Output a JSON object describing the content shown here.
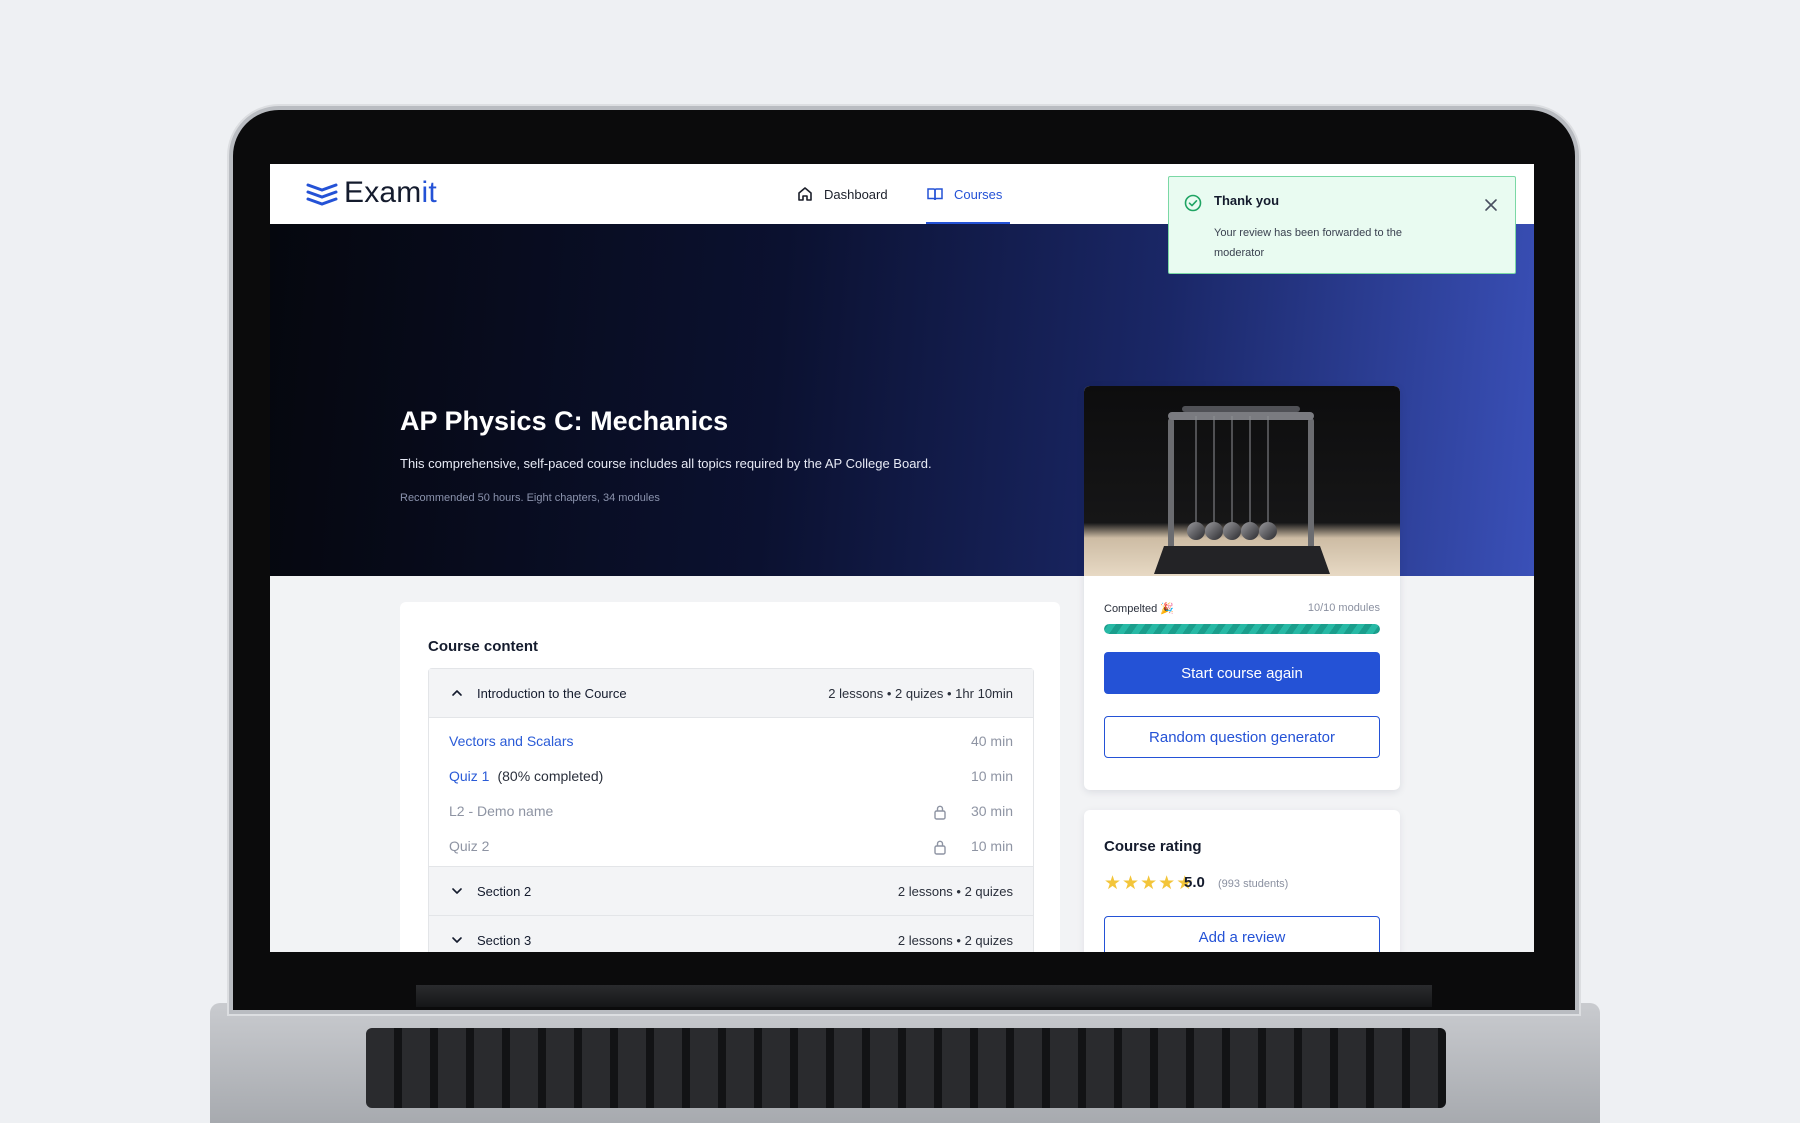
{
  "app": {
    "logo_main": "Exam",
    "logo_accent": "it"
  },
  "nav": {
    "dashboard": "Dashboard",
    "courses": "Courses"
  },
  "toast": {
    "title": "Thank you",
    "message": "Your review has been forwarded to the moderator"
  },
  "hero": {
    "title": "AP Physics C: Mechanics",
    "description": "This comprehensive, self-paced course includes all topics required by the AP College Board.",
    "meta": "Recommended 50 hours. Eight chapters, 34 modules"
  },
  "progress": {
    "label": "Compelted 🎉",
    "count": "10/10 modules",
    "fraction": 1.0
  },
  "actions": {
    "start_again": "Start course again",
    "random_generator": "Random question generator"
  },
  "rating": {
    "title": "Course rating",
    "score": "5.0",
    "students": "(993 students)",
    "stars": 5,
    "add_review": "Add a review"
  },
  "content": {
    "title": "Course content",
    "sections": [
      {
        "name": "Introduction to the Cource",
        "meta": "2 lessons • 2 quizes • 1hr 10min",
        "expanded": true,
        "lessons": [
          {
            "name": "Vectors and Scalars",
            "extra": "",
            "duration": "40 min",
            "locked": false
          },
          {
            "name": "Quiz 1",
            "extra": "(80% completed)",
            "duration": "10 min",
            "locked": false
          },
          {
            "name": "L2 - Demo name",
            "extra": "",
            "duration": "30 min",
            "locked": true
          },
          {
            "name": "Quiz 2",
            "extra": "",
            "duration": "10 min",
            "locked": true
          }
        ]
      },
      {
        "name": "Section 2",
        "meta": "2 lessons • 2 quizes",
        "expanded": false
      },
      {
        "name": "Section 3",
        "meta": "2 lessons • 2 quizes",
        "expanded": false
      }
    ]
  },
  "colors": {
    "brand": "#2452d6",
    "success_bg": "#e9fbf1",
    "success_border": "#7bd8a5",
    "progress": "#1a9e8c",
    "star": "#f3c53a"
  },
  "icons": {
    "logo": "layers-icon",
    "dashboard": "home-icon",
    "courses": "book-icon",
    "toast": "check-circle-icon",
    "close": "close-icon",
    "lock": "lock-icon"
  }
}
